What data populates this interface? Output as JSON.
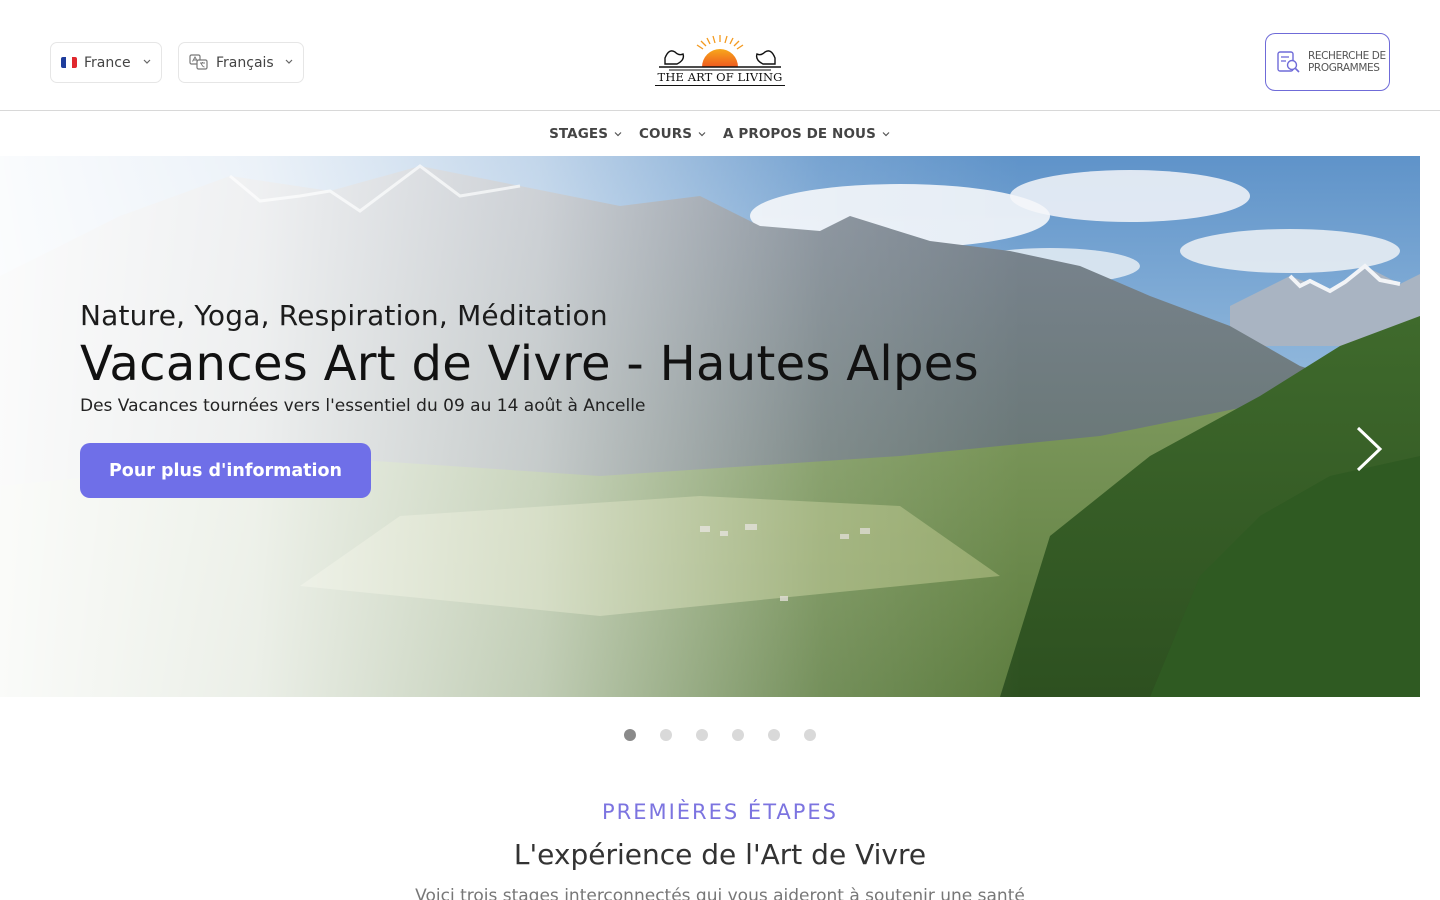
{
  "header": {
    "country_label": "France",
    "language_label": "Français",
    "logo_text": "THE ART OF LIVING",
    "search_button_label": "RECHERCHE DE PROGRAMMES"
  },
  "nav": {
    "items": [
      {
        "label": "STAGES"
      },
      {
        "label": "COURS"
      },
      {
        "label": "A PROPOS DE NOUS"
      }
    ]
  },
  "hero": {
    "subtitle": "Nature, Yoga, Respiration, Méditation",
    "title": "Vacances Art de Vivre - Hautes Alpes",
    "description": "Des Vacances tournées vers l'essentiel du 09 au 14 août à Ancelle",
    "cta_label": "Pour plus d'information",
    "slide_count": 6,
    "active_slide": 1
  },
  "section": {
    "eyebrow": "PREMIÈRES ÉTAPES",
    "title": "L'expérience de l'Art de Vivre",
    "text": "Voici trois stages interconnectés qui vous aideront à soutenir une santé"
  },
  "colors": {
    "accent": "#6f6fe8",
    "eyebrow": "#7c74e0",
    "search_border": "#6f6bd8"
  },
  "icons": [
    "chevron-down-icon",
    "language-icon",
    "search-programs-icon",
    "chevron-right-icon"
  ]
}
